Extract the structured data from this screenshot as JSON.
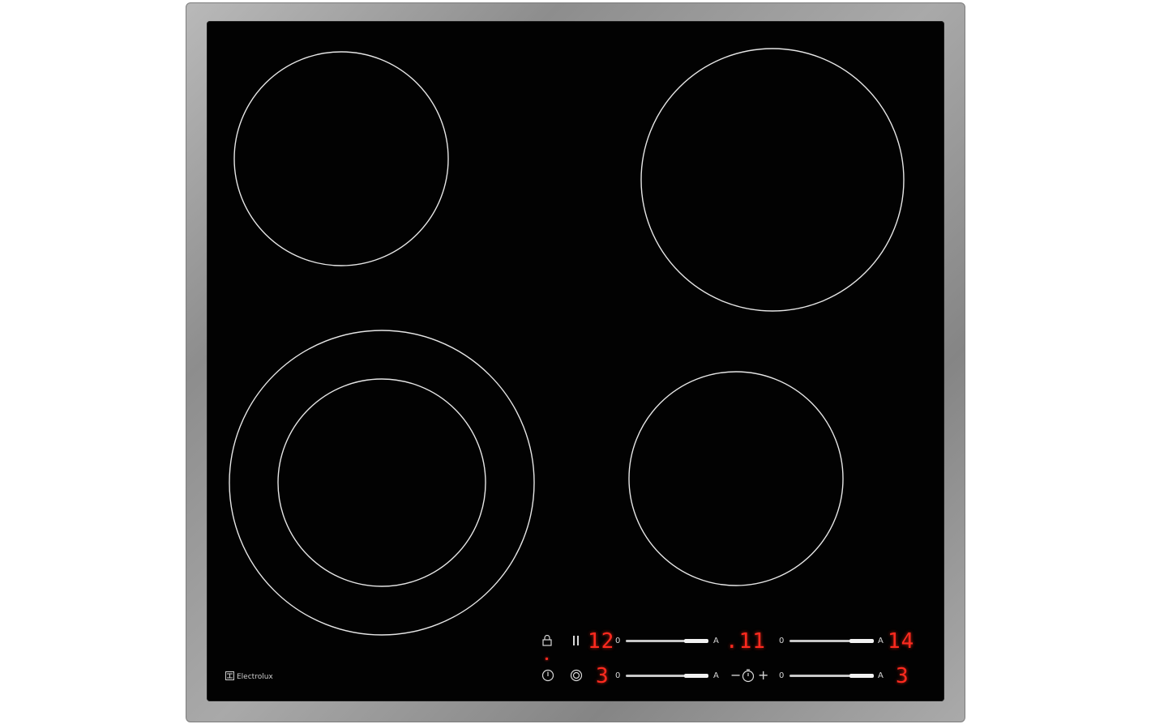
{
  "brand": {
    "name": "Electrolux"
  },
  "colors": {
    "display": "#ff2a1f",
    "glass": "#020202",
    "frame": "#9a9a9a",
    "zone_outline": "#e6e6e6"
  },
  "controls": {
    "top_row": {
      "lock_icon": "lock-icon",
      "pause_icon": "pause-icon",
      "left_display": "12",
      "left_slider": {
        "min_label": "0",
        "max_label": "A"
      },
      "timer_display": ".11",
      "right_slider": {
        "min_label": "0",
        "max_label": "A"
      },
      "right_display": "14"
    },
    "bottom_row": {
      "power_icon": "power-icon",
      "dual_zone_icon": "dual-zone-icon",
      "left_display": "3",
      "left_slider": {
        "min_label": "0",
        "max_label": "A"
      },
      "timer_minus": "−",
      "timer_icon": "timer-icon",
      "timer_plus": "+",
      "right_slider": {
        "min_label": "0",
        "max_label": "A"
      },
      "right_display": "3"
    }
  }
}
